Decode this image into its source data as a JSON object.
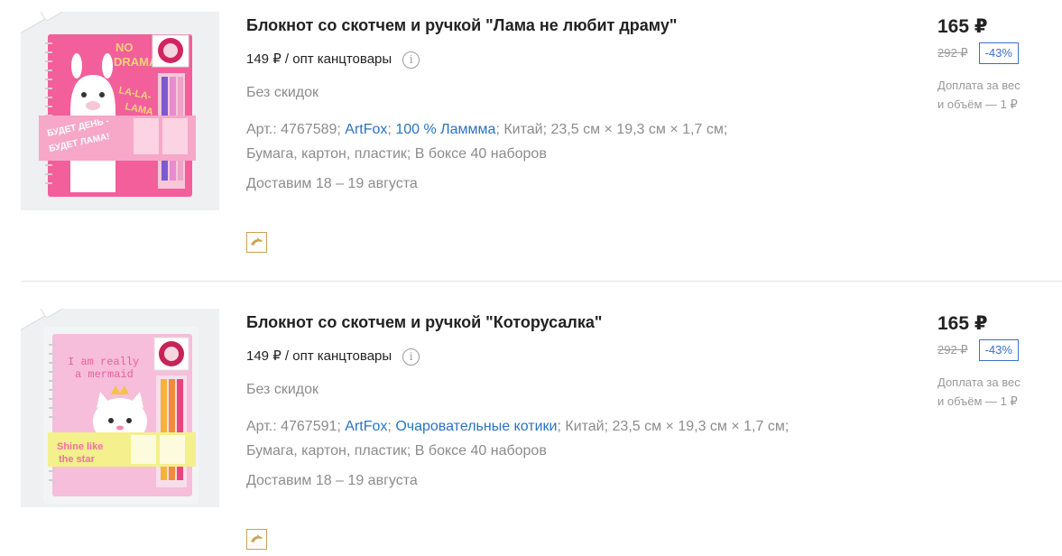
{
  "products": [
    {
      "title": "Блокнот со скотчем и ручкой \"Лама не любит драму\"",
      "wholesale_price": "149 ₽ / опт канцтовары",
      "no_discount": "Без скидок",
      "art_label": "Арт.: 4767589;",
      "brand": "ArtFox",
      "series": "100 % Ламмма",
      "country": "Китай;",
      "dims": "23,5 см × 19,3 см × 1,7 см;",
      "materials": "Бумага, картон, пластик;",
      "box": "В боксе 40 наборов",
      "delivery": "Доставим 18 – 19 августа",
      "price": "165 ₽",
      "old_price": "292 ₽",
      "discount": "-43%",
      "surcharge_line1": "Доплата за вес",
      "surcharge_line2": "и объём — 1 ₽",
      "image_text_1": "NO DRAMA",
      "image_text_2": "LA-LA-LAMA",
      "image_text_3": "БУДЕТ ДЕНЬ - БУДЕТ ЛАМА!"
    },
    {
      "title": "Блокнот со скотчем и ручкой \"Которусалка\"",
      "wholesale_price": "149 ₽ / опт канцтовары",
      "no_discount": "Без скидок",
      "art_label": "Арт.: 4767591;",
      "brand": "ArtFox",
      "series": "Очаровательные котики",
      "country": "Китай;",
      "dims": "23,5 см × 19,3 см × 1,7 см;",
      "materials": "Бумага, картон, пластик;",
      "box": "В боксе 40 наборов",
      "delivery": "Доставим 18 – 19 августа",
      "price": "165 ₽",
      "old_price": "292 ₽",
      "discount": "-43%",
      "surcharge_line1": "Доплата за вес",
      "surcharge_line2": "и объём — 1 ₽",
      "image_text_1": "I am really a mermaid",
      "image_text_2": "Shine like the star"
    }
  ],
  "icons": {
    "info": "info-icon",
    "badge": "dolphin-icon"
  },
  "colors": {
    "link": "#2a73c4",
    "discount": "#3b6fc9",
    "badge_border": "#c9a258"
  }
}
